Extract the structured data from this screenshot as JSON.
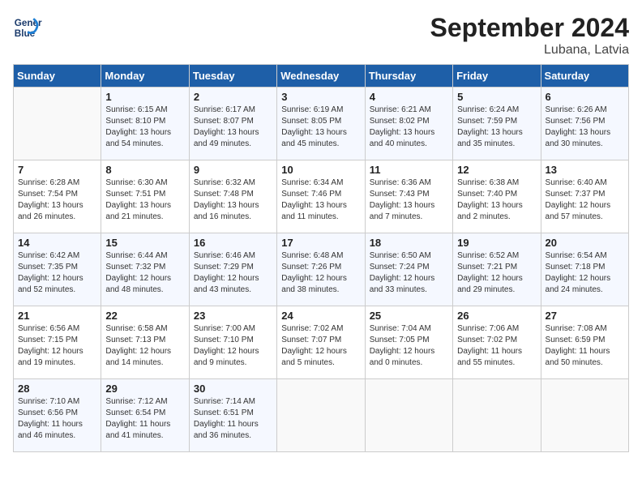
{
  "header": {
    "logo_line1": "General",
    "logo_line2": "Blue",
    "month_title": "September 2024",
    "location": "Lubana, Latvia"
  },
  "weekdays": [
    "Sunday",
    "Monday",
    "Tuesday",
    "Wednesday",
    "Thursday",
    "Friday",
    "Saturday"
  ],
  "days": [
    {
      "num": "",
      "info": ""
    },
    {
      "num": "1",
      "info": "Sunrise: 6:15 AM\nSunset: 8:10 PM\nDaylight: 13 hours\nand 54 minutes."
    },
    {
      "num": "2",
      "info": "Sunrise: 6:17 AM\nSunset: 8:07 PM\nDaylight: 13 hours\nand 49 minutes."
    },
    {
      "num": "3",
      "info": "Sunrise: 6:19 AM\nSunset: 8:05 PM\nDaylight: 13 hours\nand 45 minutes."
    },
    {
      "num": "4",
      "info": "Sunrise: 6:21 AM\nSunset: 8:02 PM\nDaylight: 13 hours\nand 40 minutes."
    },
    {
      "num": "5",
      "info": "Sunrise: 6:24 AM\nSunset: 7:59 PM\nDaylight: 13 hours\nand 35 minutes."
    },
    {
      "num": "6",
      "info": "Sunrise: 6:26 AM\nSunset: 7:56 PM\nDaylight: 13 hours\nand 30 minutes."
    },
    {
      "num": "7",
      "info": "Sunrise: 6:28 AM\nSunset: 7:54 PM\nDaylight: 13 hours\nand 26 minutes."
    },
    {
      "num": "8",
      "info": "Sunrise: 6:30 AM\nSunset: 7:51 PM\nDaylight: 13 hours\nand 21 minutes."
    },
    {
      "num": "9",
      "info": "Sunrise: 6:32 AM\nSunset: 7:48 PM\nDaylight: 13 hours\nand 16 minutes."
    },
    {
      "num": "10",
      "info": "Sunrise: 6:34 AM\nSunset: 7:46 PM\nDaylight: 13 hours\nand 11 minutes."
    },
    {
      "num": "11",
      "info": "Sunrise: 6:36 AM\nSunset: 7:43 PM\nDaylight: 13 hours\nand 7 minutes."
    },
    {
      "num": "12",
      "info": "Sunrise: 6:38 AM\nSunset: 7:40 PM\nDaylight: 13 hours\nand 2 minutes."
    },
    {
      "num": "13",
      "info": "Sunrise: 6:40 AM\nSunset: 7:37 PM\nDaylight: 12 hours\nand 57 minutes."
    },
    {
      "num": "14",
      "info": "Sunrise: 6:42 AM\nSunset: 7:35 PM\nDaylight: 12 hours\nand 52 minutes."
    },
    {
      "num": "15",
      "info": "Sunrise: 6:44 AM\nSunset: 7:32 PM\nDaylight: 12 hours\nand 48 minutes."
    },
    {
      "num": "16",
      "info": "Sunrise: 6:46 AM\nSunset: 7:29 PM\nDaylight: 12 hours\nand 43 minutes."
    },
    {
      "num": "17",
      "info": "Sunrise: 6:48 AM\nSunset: 7:26 PM\nDaylight: 12 hours\nand 38 minutes."
    },
    {
      "num": "18",
      "info": "Sunrise: 6:50 AM\nSunset: 7:24 PM\nDaylight: 12 hours\nand 33 minutes."
    },
    {
      "num": "19",
      "info": "Sunrise: 6:52 AM\nSunset: 7:21 PM\nDaylight: 12 hours\nand 29 minutes."
    },
    {
      "num": "20",
      "info": "Sunrise: 6:54 AM\nSunset: 7:18 PM\nDaylight: 12 hours\nand 24 minutes."
    },
    {
      "num": "21",
      "info": "Sunrise: 6:56 AM\nSunset: 7:15 PM\nDaylight: 12 hours\nand 19 minutes."
    },
    {
      "num": "22",
      "info": "Sunrise: 6:58 AM\nSunset: 7:13 PM\nDaylight: 12 hours\nand 14 minutes."
    },
    {
      "num": "23",
      "info": "Sunrise: 7:00 AM\nSunset: 7:10 PM\nDaylight: 12 hours\nand 9 minutes."
    },
    {
      "num": "24",
      "info": "Sunrise: 7:02 AM\nSunset: 7:07 PM\nDaylight: 12 hours\nand 5 minutes."
    },
    {
      "num": "25",
      "info": "Sunrise: 7:04 AM\nSunset: 7:05 PM\nDaylight: 12 hours\nand 0 minutes."
    },
    {
      "num": "26",
      "info": "Sunrise: 7:06 AM\nSunset: 7:02 PM\nDaylight: 11 hours\nand 55 minutes."
    },
    {
      "num": "27",
      "info": "Sunrise: 7:08 AM\nSunset: 6:59 PM\nDaylight: 11 hours\nand 50 minutes."
    },
    {
      "num": "28",
      "info": "Sunrise: 7:10 AM\nSunset: 6:56 PM\nDaylight: 11 hours\nand 46 minutes."
    },
    {
      "num": "29",
      "info": "Sunrise: 7:12 AM\nSunset: 6:54 PM\nDaylight: 11 hours\nand 41 minutes."
    },
    {
      "num": "30",
      "info": "Sunrise: 7:14 AM\nSunset: 6:51 PM\nDaylight: 11 hours\nand 36 minutes."
    },
    {
      "num": "",
      "info": ""
    },
    {
      "num": "",
      "info": ""
    },
    {
      "num": "",
      "info": ""
    },
    {
      "num": "",
      "info": ""
    }
  ]
}
